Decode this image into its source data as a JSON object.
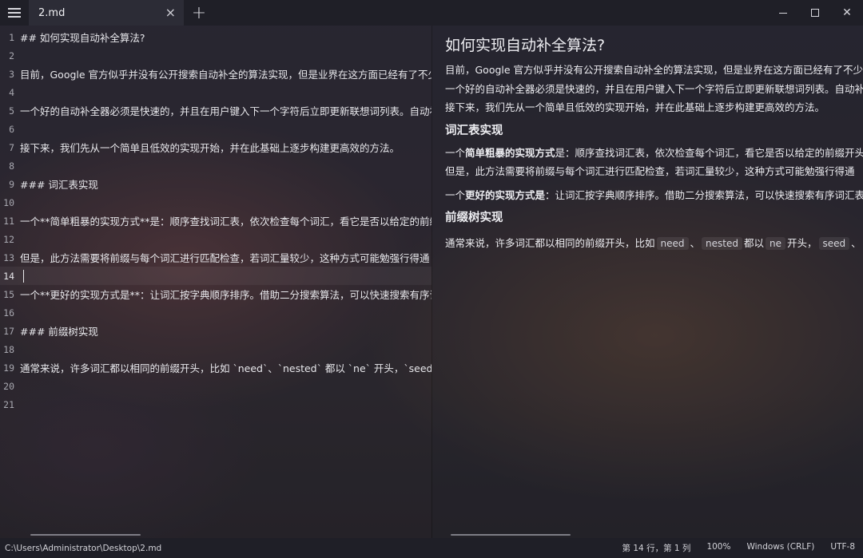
{
  "tab": {
    "title": "2.md",
    "close": "×",
    "add": "+"
  },
  "window": {
    "close": "✕"
  },
  "editor": {
    "lines": [
      {
        "n": "1",
        "text": "## 如何实现自动补全算法?"
      },
      {
        "n": "2",
        "text": ""
      },
      {
        "n": "3",
        "text": "目前，Google 官方似乎并没有公开搜索自动补全的算法实现，但是业界在这方面已经有了不少研究"
      },
      {
        "n": "4",
        "text": ""
      },
      {
        "n": "5",
        "text": "一个好的自动补全器必须是快速的，并且在用户键入下一个字符后立即更新联想词列表。自动补全器"
      },
      {
        "n": "6",
        "text": ""
      },
      {
        "n": "7",
        "text": "接下来，我们先从一个简单且低效的实现开始，并在此基础上逐步构建更高效的方法。"
      },
      {
        "n": "8",
        "text": ""
      },
      {
        "n": "9",
        "text": "### 词汇表实现"
      },
      {
        "n": "10",
        "text": ""
      },
      {
        "n": "11",
        "text": "一个**简单粗暴的实现方式**是：顺序查找词汇表，依次检查每个词汇，看它是否以给定的前缀开头"
      },
      {
        "n": "12",
        "text": ""
      },
      {
        "n": "13",
        "text": "但是，此方法需要将前缀与每个词汇进行匹配检查，若词汇量较少，这种方式可能勉强行得通"
      },
      {
        "n": "14",
        "text": ""
      },
      {
        "n": "15",
        "text": "一个**更好的实现方式是**：让词汇按字典顺序排序。借助二分搜索算法，可以快速搜索有序词汇表"
      },
      {
        "n": "16",
        "text": ""
      },
      {
        "n": "17",
        "text": "### 前缀树实现"
      },
      {
        "n": "18",
        "text": ""
      },
      {
        "n": "19",
        "text": "通常来说，许多词汇都以相同的前缀开头，比如 `need`、`nested` 都以 `ne` 开头，`seed`、"
      },
      {
        "n": "20",
        "text": ""
      },
      {
        "n": "21",
        "text": ""
      }
    ]
  },
  "preview": {
    "h2": "如何实现自动补全算法?",
    "p1": "目前，Google 官方似乎并没有公开搜索自动补全的算法实现，但是业界在这方面已经有了不少研究",
    "p2": "一个好的自动补全器必须是快速的，并且在用户键入下一个字符后立即更新联想词列表。自动补全器",
    "p3": "接下来，我们先从一个简单且低效的实现开始，并在此基础上逐步构建更高效的方法。",
    "h3a": "词汇表实现",
    "p4_pre": "一个",
    "p4_bold": "简单粗暴的实现方式",
    "p4_post": "是：顺序查找词汇表，依次检查每个词汇，看它是否以给定的前缀开头",
    "p5": "但是，此方法需要将前缀与每个词汇进行匹配检查，若词汇量较少，这种方式可能勉强行得通",
    "p6_pre": "一个",
    "p6_bold": "更好的实现方式是",
    "p6_post": "：让词汇按字典顺序排序。借助二分搜索算法，可以快速搜索有序词汇表",
    "h3b": "前缀树实现",
    "p7_a": "通常来说，许多词汇都以相同的前缀开头，比如",
    "code1": "need",
    "p7_b": "、",
    "code2": "nested",
    "p7_c": "都以",
    "code3": "ne",
    "p7_d": "开头，",
    "code4": "seed",
    "p7_e": "、"
  },
  "status": {
    "path": "C:\\Users\\Administrator\\Desktop\\2.md",
    "position": "第 14 行，第 1 列",
    "zoom": "100%",
    "line_ending": "Windows (CRLF)",
    "encoding": "UTF-8"
  }
}
